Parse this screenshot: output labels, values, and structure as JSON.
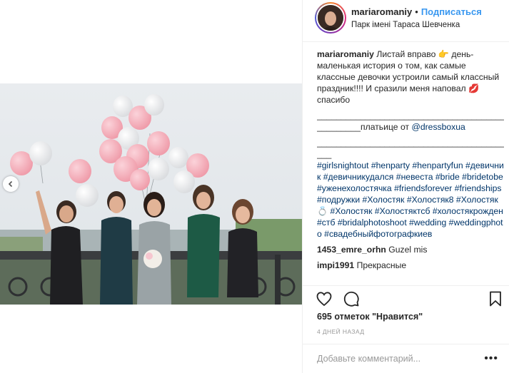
{
  "header": {
    "username": "mariaromaniy",
    "dot": "•",
    "follow_label": "Подписаться",
    "location": "Парк імені Тараса Шевченка"
  },
  "caption": {
    "username": "mariaromaniy",
    "text": "Листай вправо 👉 день-маленькая история о том, как самые классные девочки устроили самый классный праздник!!!! И сразили меня наповал 💋 спасибо",
    "separator1": "________________________________________",
    "dress_prefix": "_________платьице от ",
    "dress_mention": "@dressboxua",
    "separator2": "________________________________________",
    "separator3": "___",
    "hashtags": "#girlsnightout #henparty #henpartyfun #девичник #девичникудался #невеста #bride #bridetobe #уженехолостячка #friendsforever #friendships #подружки #Холостяк #Холостяк8 #Холостяк💍 #Холостяк #Холостяктсб #холостякрожден #стб #bridalphotoshoot #wedding #weddingphoto #свадебныйфотографкиев"
  },
  "comments": [
    {
      "user": "1453_emre_orhn",
      "text": "Guzel mis"
    },
    {
      "user": "impi1991",
      "text": "Прекрасные"
    }
  ],
  "icons": {
    "like": "heart-icon",
    "comment": "comment-icon",
    "save": "bookmark-icon",
    "prev": "chevron-left-icon",
    "more": "more-icon"
  },
  "likes_text": "695 отметок \"Нравится\"",
  "time_text": "4 ДНЕЙ НАЗАД",
  "add_comment": {
    "placeholder": "Добавьте комментарий...",
    "more": "•••"
  },
  "colors": {
    "link": "#003569",
    "follow": "#3897f0",
    "muted": "#999999",
    "border": "#efefef"
  }
}
